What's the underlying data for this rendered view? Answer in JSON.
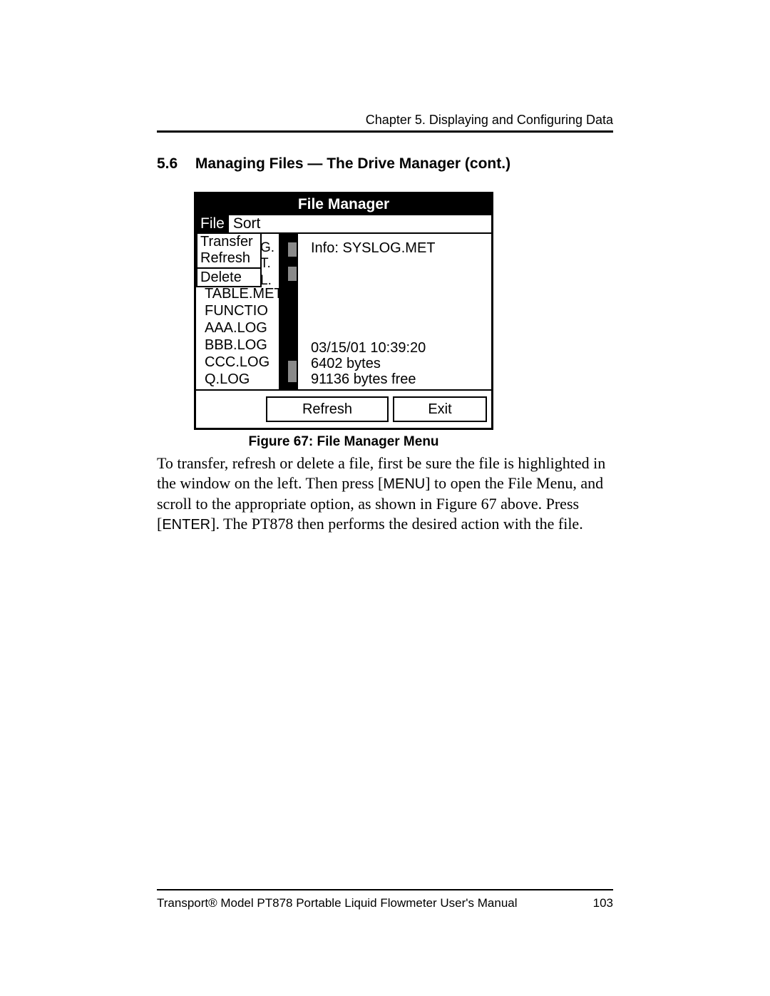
{
  "chapter_header": "Chapter 5. Displaying and Configuring Data",
  "section": {
    "number": "5.6",
    "title": "Managing Files — The Drive Manager (cont.)"
  },
  "figure": {
    "title": "File Manager",
    "menu": {
      "file": "File",
      "sort": "Sort"
    },
    "dropdown": {
      "transfer": "Transfer",
      "refresh": "Refresh",
      "delete": "Delete"
    },
    "frag1": "G.",
    "frag2": "T.",
    "frag3": "L.",
    "files": {
      "f1": "TABLE.MET",
      "f2": "FUNCTIO",
      "f3": "AAA.LOG",
      "f4": "BBB.LOG",
      "f5": "CCC.LOG",
      "f6": "Q.LOG"
    },
    "info_label": "Info: SYSLOG.MET",
    "timestamp": "03/15/01   10:39:20",
    "size": "6402 bytes",
    "free": "91136 bytes free",
    "buttons": {
      "refresh": "Refresh",
      "exit": "Exit"
    },
    "caption": "Figure 67: File Manager Menu"
  },
  "paragraph": {
    "p1a": "To transfer, refresh or delete a file, first be sure the file is highlighted in the window on the left. Then press [",
    "menu_key": "MENU",
    "p1b": "] to open the File Menu, and scroll to the appropriate option, as shown in Figure 67 above. Press [",
    "enter_key": "ENTER",
    "p1c": "]. The PT878 then performs the desired action with the file."
  },
  "footer": {
    "left": "Transport® Model PT878 Portable Liquid Flowmeter User's Manual",
    "right": "103"
  }
}
